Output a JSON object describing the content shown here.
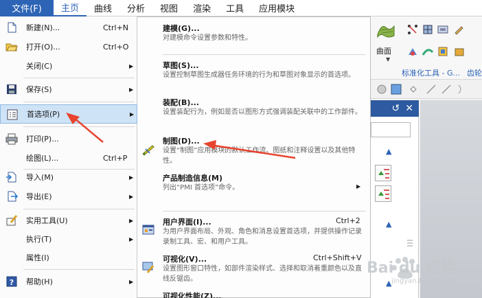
{
  "menubar": {
    "file_tab": "文件(F)",
    "tabs": [
      "主页",
      "曲线",
      "分析",
      "视图",
      "渲染",
      "工具",
      "应用模块"
    ]
  },
  "ribbon": {
    "surface_label": "曲面",
    "group_label": "标准化工具 - G...",
    "group_extra": "齿轮"
  },
  "file_menu": {
    "items": [
      {
        "icon": "new-document-icon",
        "label": "新建(N)...",
        "shortcut": "Ctrl+N"
      },
      {
        "icon": "open-folder-icon",
        "label": "打开(O)...",
        "shortcut": "Ctrl+O"
      },
      {
        "icon": "",
        "label": "关闭(C)",
        "shortcut": "",
        "submenu": true
      },
      {
        "icon": "save-disk-icon",
        "label": "保存(S)",
        "shortcut": "",
        "submenu": true
      },
      {
        "icon": "preferences-icon",
        "label": "首选项(P)",
        "shortcut": "",
        "submenu": true
      },
      {
        "icon": "printer-icon",
        "label": "打印(P)...",
        "shortcut": ""
      },
      {
        "icon": "",
        "label": "绘图(L)...",
        "shortcut": "Ctrl+P"
      },
      {
        "icon": "import-icon",
        "label": "导入(M)",
        "shortcut": "",
        "submenu": true
      },
      {
        "icon": "export-icon",
        "label": "导出(E)",
        "shortcut": "",
        "submenu": true
      },
      {
        "icon": "utility-tools-icon",
        "label": "实用工具(U)",
        "shortcut": "",
        "submenu": true
      },
      {
        "icon": "",
        "label": "执行(T)",
        "shortcut": "",
        "submenu": true
      },
      {
        "icon": "",
        "label": "属性(I)",
        "shortcut": ""
      },
      {
        "icon": "help-icon",
        "label": "帮助(H)",
        "shortcut": "",
        "submenu": true
      }
    ]
  },
  "pref_menu": {
    "items": [
      {
        "icon": "",
        "title": "建模(G)...",
        "desc": "对建模命令设置参数和特性。",
        "shortcut": ""
      },
      {
        "icon": "",
        "title": "草图(S)...",
        "desc": "设置控制草图生成器任务环境的行为和草图对象显示的首选项。",
        "shortcut": ""
      },
      {
        "icon": "",
        "title": "装配(B)...",
        "desc": "设置装配行为，例如是否以图形方式强调装配关联中的工作部件。",
        "shortcut": ""
      },
      {
        "icon": "drafting-icon",
        "title": "制图(D)...",
        "desc": "设置“制图”应用模块的默认工作流、图纸和注释设置以及其他特性。",
        "shortcut": ""
      },
      {
        "icon": "",
        "title": "产品制造信息(M)",
        "desc": "列出“PMI 首选项”命令。",
        "shortcut": "",
        "submenu": true
      },
      {
        "icon": "user-interface-icon",
        "title": "用户界面(I)...",
        "desc": "为用户界面布局、外观、角色和消息设置首选项，并提供操作记录录制工具、宏、和用户工具。",
        "shortcut": "Ctrl+2"
      },
      {
        "icon": "visualization-icon",
        "title": "可视化(V)...",
        "desc": "设置图形窗口特性，如部件渲染样式、选择和取消着重颜色以及直线反锯齿。",
        "shortcut": "Ctrl+Shift+V"
      },
      {
        "icon": "",
        "title": "可视化性能(Z)...",
        "desc": "",
        "shortcut": ""
      }
    ]
  },
  "watermark": {
    "text": "Bai du 经验",
    "sub": "jingyan.baidu.com"
  },
  "colors": {
    "accent": "#2d64b5",
    "selection": "#cfe3f7",
    "annotation_arrow": "#e8432e"
  }
}
